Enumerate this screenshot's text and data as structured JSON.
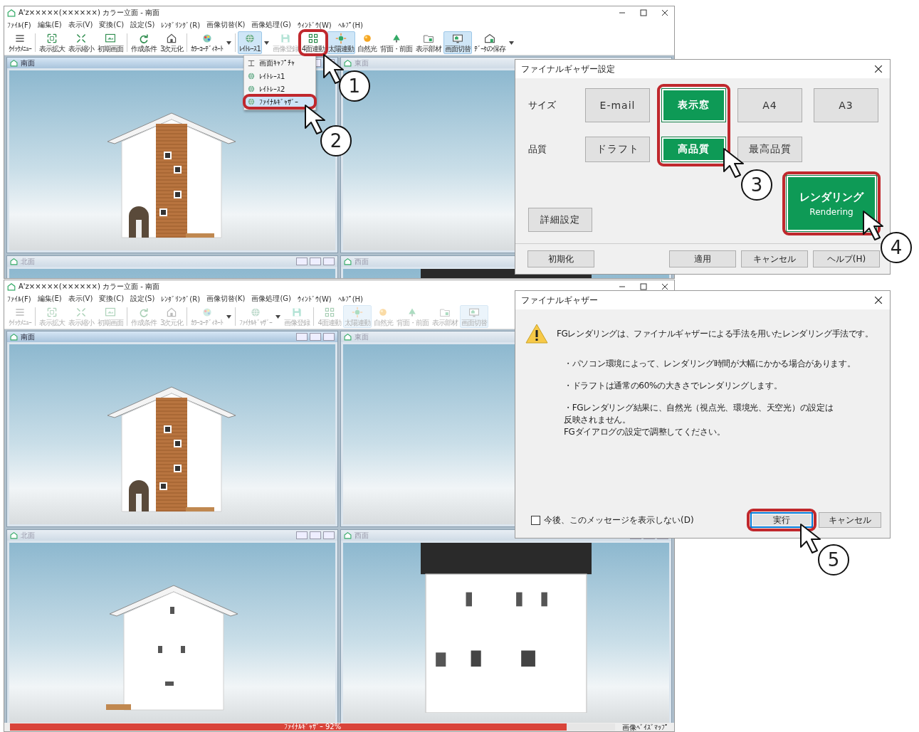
{
  "windows": [
    {
      "title": "A'z×××××(××××××) カラー立面 - 南面",
      "menu": [
        "ﾌｧｲﾙ(F)",
        "編集(E)",
        "表示(V)",
        "変換(C)",
        "設定(S)",
        "ﾚﾝﾀﾞﾘﾝｸﾞ(R)",
        "画像切替(K)",
        "画像処理(G)",
        "ｳｨﾝﾄﾞｳ(W)",
        "ﾍﾙﾌﾟ(H)"
      ],
      "toolbar": [
        {
          "label": "ｸｲｯｸﾒﾆｭｰ",
          "kind": "menu",
          "pressed": false,
          "disabled": false,
          "dropdown": false,
          "separator_before": false
        },
        {
          "label": "表示拡大",
          "kind": "expand",
          "pressed": false,
          "disabled": false,
          "dropdown": false,
          "separator_before": true
        },
        {
          "label": "表示縮小",
          "kind": "shrink",
          "pressed": false,
          "disabled": false,
          "dropdown": false,
          "separator_before": false
        },
        {
          "label": "初期画面",
          "kind": "screen",
          "pressed": false,
          "disabled": false,
          "dropdown": false,
          "separator_before": false
        },
        {
          "label": "作成条件",
          "kind": "cond",
          "pressed": false,
          "disabled": false,
          "dropdown": false,
          "separator_before": true
        },
        {
          "label": "3次元化",
          "kind": "cube",
          "pressed": false,
          "disabled": false,
          "dropdown": false,
          "separator_before": false
        },
        {
          "label": "ｶﾗｰｺｰﾃﾞｨﾈｰﾄ",
          "kind": "palette",
          "pressed": false,
          "disabled": false,
          "dropdown": true,
          "separator_before": true
        },
        {
          "label": "ﾚｲﾄﾚｰｽ1",
          "kind": "globe",
          "pressed": true,
          "disabled": false,
          "dropdown": true,
          "separator_before": true
        },
        {
          "label": "画像登録",
          "kind": "save",
          "pressed": false,
          "disabled": true,
          "dropdown": false,
          "separator_before": false
        },
        {
          "label": "4面連動",
          "kind": "grid",
          "pressed": false,
          "disabled": false,
          "dropdown": false,
          "separator_before": false
        },
        {
          "label": "太陽連動",
          "kind": "sunlink",
          "pressed": true,
          "disabled": false,
          "dropdown": false,
          "separator_before": false
        },
        {
          "label": "自然光",
          "kind": "sun",
          "pressed": false,
          "disabled": false,
          "dropdown": false,
          "separator_before": false
        },
        {
          "label": "背面・前面",
          "kind": "tree",
          "pressed": false,
          "disabled": false,
          "dropdown": false,
          "separator_before": false
        },
        {
          "label": "表示部材",
          "kind": "folder",
          "pressed": false,
          "disabled": false,
          "dropdown": false,
          "separator_before": false
        },
        {
          "label": "画面切替",
          "kind": "switch",
          "pressed": true,
          "disabled": false,
          "dropdown": false,
          "separator_before": false
        },
        {
          "label": "ﾃﾞｰﾀの保存",
          "kind": "house",
          "pressed": false,
          "disabled": false,
          "dropdown": true,
          "separator_before": false
        }
      ],
      "dropdown_menu": [
        {
          "label": "画面ｷｬﾌﾟﾁｬ",
          "kind": "capture",
          "selected": false
        },
        {
          "label": "ﾚｲﾄﾚｰｽ1",
          "kind": "globe",
          "selected": false
        },
        {
          "label": "ﾚｲﾄﾚｰｽ2",
          "kind": "globe",
          "selected": false
        },
        {
          "label": "ﾌｧｲﾅﾙｷﾞｬｻﾞｰ",
          "kind": "globe",
          "selected": true
        }
      ],
      "panes": [
        {
          "title": "南面",
          "active": true,
          "kind": "gable-striped"
        },
        {
          "title": "東面",
          "active": false,
          "kind": "flat-side"
        },
        {
          "title": "北面",
          "active": false,
          "kind": "gable-plain"
        },
        {
          "title": "西面",
          "active": false,
          "kind": "flat-back"
        }
      ]
    },
    {
      "title": "A'z×××××(××××××) カラー立面 - 南面",
      "menu": [
        "ﾌｧｲﾙ(F)",
        "編集(E)",
        "表示(V)",
        "変換(C)",
        "設定(S)",
        "ﾚﾝﾀﾞﾘﾝｸﾞ(R)",
        "画像切替(K)",
        "画像処理(G)",
        "ｳｨﾝﾄﾞｳ(W)",
        "ﾍﾙﾌﾟ(H)"
      ],
      "toolbar": [
        {
          "label": "ｸｲｯｸﾒﾆｭｰ",
          "kind": "menu",
          "pressed": false,
          "disabled": true,
          "dropdown": false,
          "separator_before": false
        },
        {
          "label": "表示拡大",
          "kind": "expand",
          "pressed": false,
          "disabled": true,
          "dropdown": false,
          "separator_before": true
        },
        {
          "label": "表示縮小",
          "kind": "shrink",
          "pressed": false,
          "disabled": true,
          "dropdown": false,
          "separator_before": false
        },
        {
          "label": "初期画面",
          "kind": "screen",
          "pressed": false,
          "disabled": true,
          "dropdown": false,
          "separator_before": false
        },
        {
          "label": "作成条件",
          "kind": "cond",
          "pressed": false,
          "disabled": true,
          "dropdown": false,
          "separator_before": true
        },
        {
          "label": "3次元化",
          "kind": "cube",
          "pressed": false,
          "disabled": true,
          "dropdown": false,
          "separator_before": false
        },
        {
          "label": "ｶﾗｰｺｰﾃﾞｨﾈｰﾄ",
          "kind": "palette",
          "pressed": false,
          "disabled": true,
          "dropdown": true,
          "separator_before": true
        },
        {
          "label": "ﾌｧｲﾅﾙｷﾞｬｻﾞｰ",
          "kind": "globe",
          "pressed": false,
          "disabled": true,
          "dropdown": true,
          "separator_before": true
        },
        {
          "label": "画像登録",
          "kind": "save",
          "pressed": false,
          "disabled": true,
          "dropdown": false,
          "separator_before": false
        },
        {
          "label": "4面連動",
          "kind": "grid",
          "pressed": false,
          "disabled": true,
          "dropdown": false,
          "separator_before": true
        },
        {
          "label": "太陽連動",
          "kind": "sunlink",
          "pressed": true,
          "disabled": true,
          "dropdown": false,
          "separator_before": false
        },
        {
          "label": "自然光",
          "kind": "sun",
          "pressed": false,
          "disabled": true,
          "dropdown": false,
          "separator_before": false
        },
        {
          "label": "背面・前面",
          "kind": "tree",
          "pressed": false,
          "disabled": true,
          "dropdown": false,
          "separator_before": false
        },
        {
          "label": "表示部材",
          "kind": "folder",
          "pressed": false,
          "disabled": true,
          "dropdown": false,
          "separator_before": false
        },
        {
          "label": "画面切替",
          "kind": "switch",
          "pressed": true,
          "disabled": true,
          "dropdown": false,
          "separator_before": false
        }
      ],
      "panes": [
        {
          "title": "南面",
          "active": true,
          "kind": "gable-striped"
        },
        {
          "title": "東面",
          "active": false,
          "kind": "flat-side"
        },
        {
          "title": "北面",
          "active": false,
          "kind": "gable-plain"
        },
        {
          "title": "西面",
          "active": false,
          "kind": "flat-back"
        }
      ],
      "status_bar": {
        "progress": {
          "label": "ﾌｧｲﾅﾙｷﾞｬｻﾞｰ 92%",
          "level": 0.92
        },
        "text": "画像ﾍﾞｲｽﾞﾏｯﾌﾟ"
      }
    }
  ],
  "settings_dialog": {
    "title": "ファイナルギャザー設定",
    "rows": [
      {
        "label": "サイズ",
        "options": [
          {
            "label": "E-mail",
            "selected": false
          },
          {
            "label": "表示窓",
            "selected": true
          },
          {
            "label": "A4",
            "selected": false
          },
          {
            "label": "A3",
            "selected": false
          }
        ]
      },
      {
        "label": "品質",
        "options": [
          {
            "label": "ドラフト",
            "selected": false
          },
          {
            "label": "高品質",
            "selected": true
          },
          {
            "label": "最高品質",
            "selected": false
          }
        ]
      }
    ],
    "detail_button": "詳細設定",
    "render_button": {
      "label": "レンダリング",
      "sublabel": "Rendering"
    },
    "footer_buttons": [
      "初期化",
      "適用",
      "キャンセル",
      "ヘルプ(H)"
    ]
  },
  "confirm_dialog": {
    "title": "ファイナルギャザー",
    "message": "FGレンダリングは、ファイナルギャザーによる手法を用いたレンダリング手法です。",
    "notes": [
      {
        "lines": [
          "・パソコン環境によって、レンダリング時間が大幅にかかる場合があります。"
        ]
      },
      {
        "lines": [
          "・ドラフトは通常の60%の大きさでレンダリングします。"
        ]
      },
      {
        "lines": [
          "・FGレンダリング結果に、自然光（視点光、環境光、天空光）の設定は",
          "反映されません。",
          "FGダイアログの設定で調整してください。"
        ]
      }
    ],
    "checkbox": {
      "label": "今後、このメッセージを表示しない(D)",
      "checked": false
    },
    "buttons": [
      {
        "label": "実行",
        "default": true
      },
      {
        "label": "キャンセル",
        "default": false
      }
    ]
  },
  "callouts": [
    {
      "number": "1"
    },
    {
      "number": "2"
    },
    {
      "number": "3"
    },
    {
      "number": "4"
    },
    {
      "number": "5"
    }
  ]
}
